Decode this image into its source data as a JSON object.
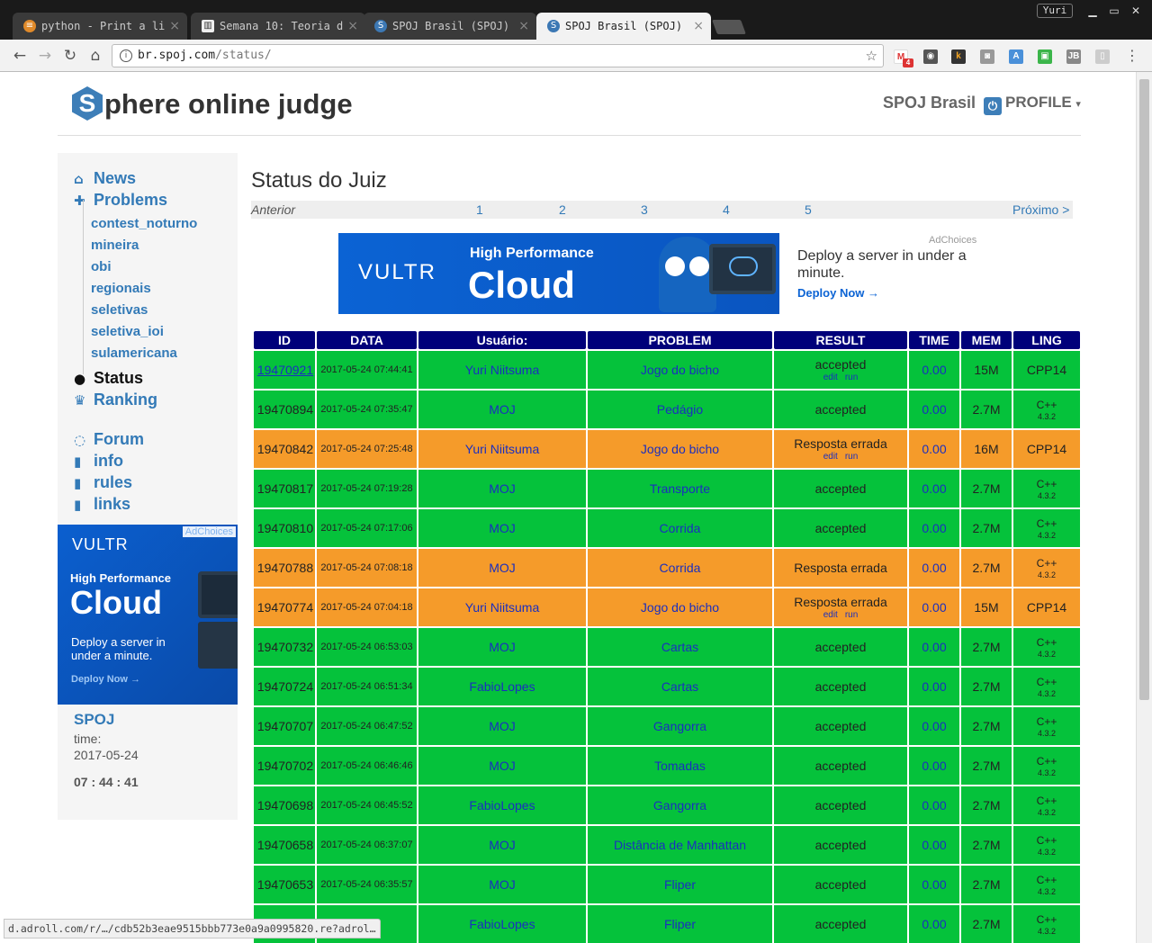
{
  "browser": {
    "tabs": [
      {
        "title": "python - Print a li"
      },
      {
        "title": "Semana 10: Teoria d"
      },
      {
        "title": "SPOJ Brasil (SPOJ)"
      },
      {
        "title": "SPOJ Brasil (SPOJ)"
      }
    ],
    "user_badge": "Yuri",
    "url_host": "br.spoj.com",
    "url_path": "/status/",
    "gmail_count": "4",
    "status_url": "d.adroll.com/r/…/cdb52b3eae9515bbb773e0a9a0995820.re?adrol…"
  },
  "header": {
    "logo_letter": "S",
    "logo_rest": "phere online judge",
    "brand_link": "SPOJ Brasil",
    "profile_label": "PROFILE"
  },
  "sidebar": {
    "news": "News",
    "problems": "Problems",
    "sub": [
      "contest_noturno",
      "mineira",
      "obi",
      "regionais",
      "seletivas",
      "seletiva_ioi",
      "sulamericana"
    ],
    "status": "Status",
    "ranking": "Ranking",
    "forum": "Forum",
    "info": "info",
    "rules": "rules",
    "links": "links",
    "clock_title": "SPOJ",
    "clock_time_label": "time:",
    "clock_date": "2017-05-24",
    "clock_hms": "07 : 44 : 41"
  },
  "side_ad": {
    "adchoices": "AdChoices",
    "brand": "VULTR",
    "headline1": "High Performance",
    "headline2": "Cloud",
    "body": "Deploy a server in under a minute.",
    "cta": "Deploy Now →"
  },
  "top_ad": {
    "brand": "VULTR",
    "headline1": "High Performance",
    "headline2": "Cloud",
    "adchoices": "AdChoices",
    "body": "Deploy a server in under a minute.",
    "cta": "Deploy Now →"
  },
  "main": {
    "title": "Status do Juiz",
    "pager": {
      "prev": "Anterior",
      "pages": [
        "1",
        "2",
        "3",
        "4",
        "5"
      ],
      "next": "Próximo >"
    },
    "columns": [
      "ID",
      "DATA",
      "Usuário:",
      "PROBLEM",
      "RESULT",
      "TIME",
      "MEM",
      "LING"
    ],
    "rows": [
      {
        "id": "19470921",
        "date": "2017-05-24 07:44:41",
        "user": "Yuri Niitsuma",
        "problem": "Jogo do bicho",
        "result": "accepted",
        "edit": "edit",
        "run": "run",
        "time": "0.00",
        "mem": "15M",
        "lang": "CPP14",
        "lang_ver": "",
        "status": "ok",
        "id_link": true
      },
      {
        "id": "19470894",
        "date": "2017-05-24 07:35:47",
        "user": "MOJ",
        "problem": "Pedágio",
        "result": "accepted",
        "edit": "",
        "run": "",
        "time": "0.00",
        "mem": "2.7M",
        "lang": "C++",
        "lang_ver": "4.3.2",
        "status": "ok",
        "id_link": false
      },
      {
        "id": "19470842",
        "date": "2017-05-24 07:25:48",
        "user": "Yuri Niitsuma",
        "problem": "Jogo do bicho",
        "result": "Resposta errada",
        "edit": "edit",
        "run": "run",
        "time": "0.00",
        "mem": "16M",
        "lang": "CPP14",
        "lang_ver": "",
        "status": "wa",
        "id_link": false
      },
      {
        "id": "19470817",
        "date": "2017-05-24 07:19:28",
        "user": "MOJ",
        "problem": "Transporte",
        "result": "accepted",
        "edit": "",
        "run": "",
        "time": "0.00",
        "mem": "2.7M",
        "lang": "C++",
        "lang_ver": "4.3.2",
        "status": "ok",
        "id_link": false
      },
      {
        "id": "19470810",
        "date": "2017-05-24 07:17:06",
        "user": "MOJ",
        "problem": "Corrida",
        "result": "accepted",
        "edit": "",
        "run": "",
        "time": "0.00",
        "mem": "2.7M",
        "lang": "C++",
        "lang_ver": "4.3.2",
        "status": "ok",
        "id_link": false
      },
      {
        "id": "19470788",
        "date": "2017-05-24 07:08:18",
        "user": "MOJ",
        "problem": "Corrida",
        "result": "Resposta errada",
        "edit": "",
        "run": "",
        "time": "0.00",
        "mem": "2.7M",
        "lang": "C++",
        "lang_ver": "4.3.2",
        "status": "wa",
        "id_link": false
      },
      {
        "id": "19470774",
        "date": "2017-05-24 07:04:18",
        "user": "Yuri Niitsuma",
        "problem": "Jogo do bicho",
        "result": "Resposta errada",
        "edit": "edit",
        "run": "run",
        "time": "0.00",
        "mem": "15M",
        "lang": "CPP14",
        "lang_ver": "",
        "status": "wa",
        "id_link": false
      },
      {
        "id": "19470732",
        "date": "2017-05-24 06:53:03",
        "user": "MOJ",
        "problem": "Cartas",
        "result": "accepted",
        "edit": "",
        "run": "",
        "time": "0.00",
        "mem": "2.7M",
        "lang": "C++",
        "lang_ver": "4.3.2",
        "status": "ok",
        "id_link": false
      },
      {
        "id": "19470724",
        "date": "2017-05-24 06:51:34",
        "user": "FabioLopes",
        "problem": "Cartas",
        "result": "accepted",
        "edit": "",
        "run": "",
        "time": "0.00",
        "mem": "2.7M",
        "lang": "C++",
        "lang_ver": "4.3.2",
        "status": "ok",
        "id_link": false
      },
      {
        "id": "19470707",
        "date": "2017-05-24 06:47:52",
        "user": "MOJ",
        "problem": "Gangorra",
        "result": "accepted",
        "edit": "",
        "run": "",
        "time": "0.00",
        "mem": "2.7M",
        "lang": "C++",
        "lang_ver": "4.3.2",
        "status": "ok",
        "id_link": false
      },
      {
        "id": "19470702",
        "date": "2017-05-24 06:46:46",
        "user": "MOJ",
        "problem": "Tomadas",
        "result": "accepted",
        "edit": "",
        "run": "",
        "time": "0.00",
        "mem": "2.7M",
        "lang": "C++",
        "lang_ver": "4.3.2",
        "status": "ok",
        "id_link": false
      },
      {
        "id": "19470698",
        "date": "2017-05-24 06:45:52",
        "user": "FabioLopes",
        "problem": "Gangorra",
        "result": "accepted",
        "edit": "",
        "run": "",
        "time": "0.00",
        "mem": "2.7M",
        "lang": "C++",
        "lang_ver": "4.3.2",
        "status": "ok",
        "id_link": false
      },
      {
        "id": "19470658",
        "date": "2017-05-24 06:37:07",
        "user": "MOJ",
        "problem": "Distância de Manhattan",
        "result": "accepted",
        "edit": "",
        "run": "",
        "time": "0.00",
        "mem": "2.7M",
        "lang": "C++",
        "lang_ver": "4.3.2",
        "status": "ok",
        "id_link": false
      },
      {
        "id": "19470653",
        "date": "2017-05-24 06:35:57",
        "user": "MOJ",
        "problem": "Fliper",
        "result": "accepted",
        "edit": "",
        "run": "",
        "time": "0.00",
        "mem": "2.7M",
        "lang": "C++",
        "lang_ver": "4.3.2",
        "status": "ok",
        "id_link": false
      },
      {
        "id": "",
        "date": "34:50",
        "user": "FabioLopes",
        "problem": "Fliper",
        "result": "accepted",
        "edit": "",
        "run": "",
        "time": "0.00",
        "mem": "2.7M",
        "lang": "C++",
        "lang_ver": "4.3.2",
        "status": "ok",
        "id_link": false
      }
    ]
  },
  "colors": {
    "header_blue": "#00007a",
    "accepted_green": "#05c23b",
    "wrong_orange": "#f59b2a",
    "link_blue": "#337ab7"
  }
}
